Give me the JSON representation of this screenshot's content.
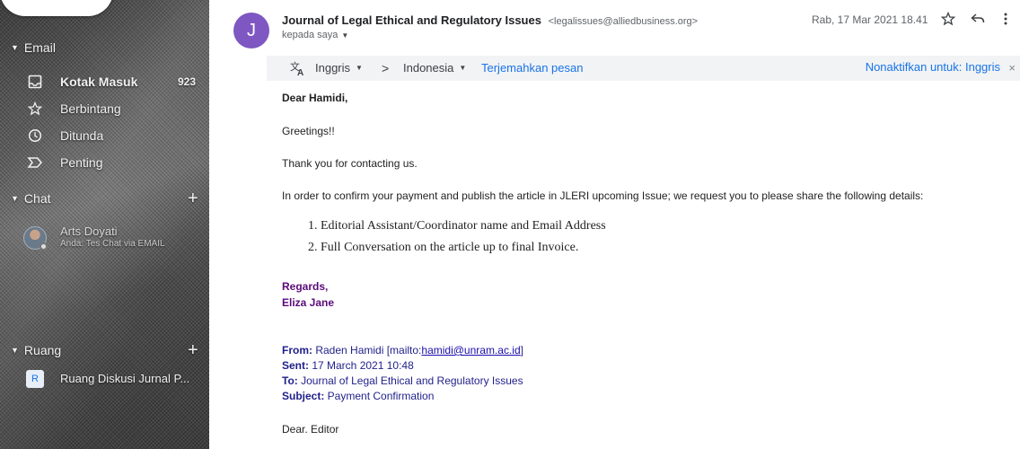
{
  "sidebar": {
    "email_section": "Email",
    "nav": [
      {
        "label": "Kotak Masuk",
        "count": "923",
        "icon": "inbox-icon",
        "active": true
      },
      {
        "label": "Berbintang",
        "count": "",
        "icon": "star-icon",
        "active": false
      },
      {
        "label": "Ditunda",
        "count": "",
        "icon": "clock-icon",
        "active": false
      },
      {
        "label": "Penting",
        "count": "",
        "icon": "important-icon",
        "active": false
      }
    ],
    "chat_section": "Chat",
    "chat_contact": {
      "name": "Arts Doyati",
      "subtitle": "Anda: Tes Chat via EMAIL"
    },
    "room_section": "Ruang",
    "room": {
      "badge": "R",
      "label": "Ruang Diskusi Jurnal P..."
    }
  },
  "message": {
    "avatar_letter": "J",
    "avatar_color": "#7e57c2",
    "sender_name": "Journal of Legal Ethical and Regulatory Issues",
    "sender_email": "<legalissues@alliedbusiness.org>",
    "to": "kepada saya",
    "date": "Rab, 17 Mar 2021 18.41"
  },
  "translate": {
    "source_lang": "Inggris",
    "target_lang": "Indonesia",
    "translate_link": "Terjemahkan pesan",
    "disable_link": "Nonaktifkan untuk: Inggris",
    "close": "×"
  },
  "body": {
    "salutation": "Dear Hamidi,",
    "greeting": "Greetings!!",
    "thanks": "Thank you  for contacting us.",
    "request": "In order to confirm your payment and publish the article in JLERI upcoming Issue; we request you to please share the following details:",
    "list": [
      "1.   Editorial Assistant/Coordinator name and  Email Address",
      "2.   Full Conversation on the article up to final Invoice."
    ],
    "regards": "Regards,",
    "signature": "Eliza Jane",
    "quote": {
      "from_label": "From:",
      "from_value": " Raden Hamidi [mailto:",
      "from_email": "hamidi@unram.ac.id",
      "from_end": "]",
      "sent_label": "Sent:",
      "sent_value": " 17 March 2021 10:48",
      "to_label": "To:",
      "to_value": " Journal of Legal Ethical and Regulatory Issues",
      "subject_label": "Subject:",
      "subject_value": " Payment Confirmation"
    },
    "closing": "Dear. Editor"
  }
}
